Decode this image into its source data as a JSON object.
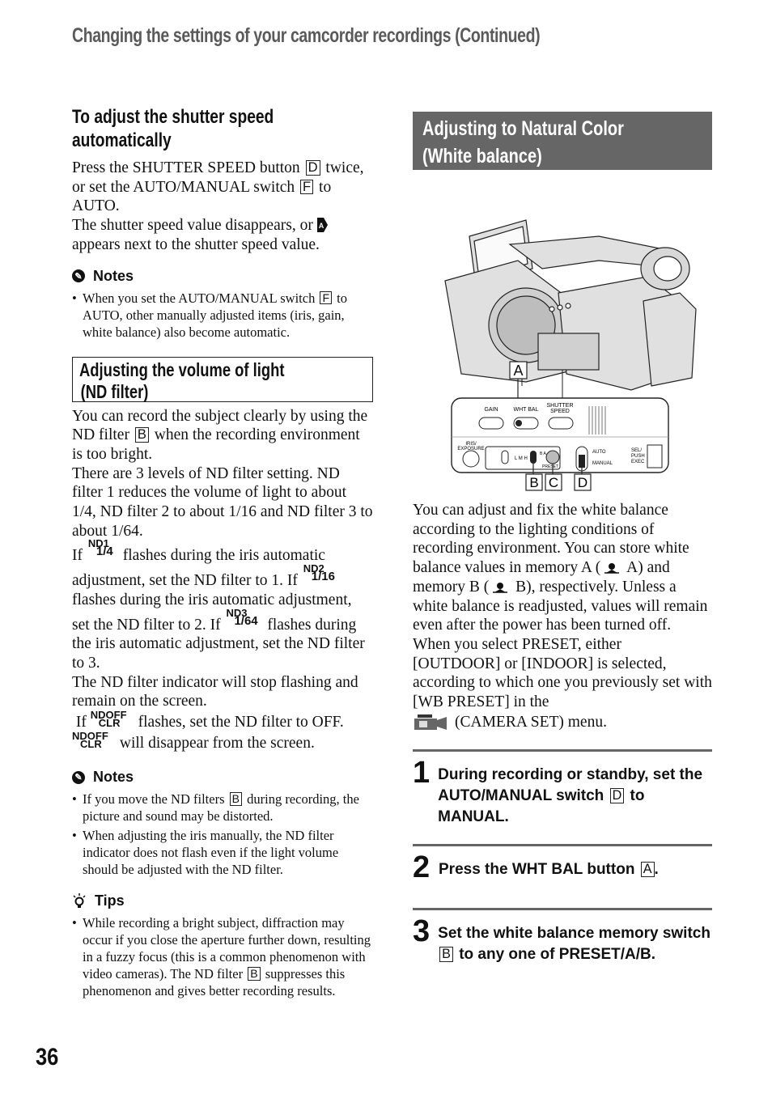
{
  "header": {
    "title": "Changing the settings of your camcorder recordings (Continued)"
  },
  "left": {
    "shutter": {
      "heading_line1": "To adjust the shutter speed",
      "heading_line2": "automatically",
      "p1_a": "Press the SHUTTER SPEED button",
      "p1_box1": "D",
      "p1_b": "twice, or set the AUTO/MANUAL switch",
      "p1_box2": "F",
      "p1_c": "to AUTO.",
      "p2_a": "The shutter speed value disappears, or",
      "p2_b": "appears next to the shutter speed value.",
      "auto_icon_label": "A"
    },
    "notes1": {
      "title": "Notes",
      "items": [
        {
          "a": "When you set the AUTO/MANUAL switch",
          "box": "F",
          "b": "to AUTO, other manually adjusted items (iris, gain, white balance) also become automatic."
        }
      ]
    },
    "nd": {
      "heading_line1": "Adjusting the volume of light",
      "heading_line2": "(ND filter)",
      "p1_a": "You can record the subject clearly by using the ND filter",
      "p1_box": "B",
      "p1_b": "when the recording environment is too bright.",
      "p2": "There are 3 levels of ND filter setting. ND filter 1 reduces the volume of light to about 1/4, ND filter 2 to about 1/16 and ND filter 3 to about 1/64.",
      "p3_if": "If",
      "p3_a": "flashes during the iris automatic adjustment, set the ND filter to 1. If",
      "p3_b": "flashes during the iris automatic adjustment, set the ND filter to 2. If",
      "p3_c": "flashes during the iris automatic adjustment, set the ND filter to 3.",
      "p4": "The ND filter indicator will stop flashing and remain on the screen.",
      "p5_if": "If",
      "p5_a": "flashes, set the ND filter to OFF.",
      "p5_b": "will disappear from the screen.",
      "icons": {
        "nd1_top": "ND1",
        "nd1_bot": "1/4",
        "nd2_top": "ND2",
        "nd2_bot": "1/16",
        "nd3_top": "ND3",
        "nd3_bot": "1/64",
        "ndoff_top": "NDOFF",
        "ndoff_bot": "CLR"
      }
    },
    "notes2": {
      "title": "Notes",
      "items": [
        {
          "a": "If you move the ND filters",
          "box": "B",
          "b": "during recording, the picture and sound may be distorted."
        },
        {
          "a": "When adjusting the iris manually, the ND filter indicator does not flash even if the light volume should be adjusted with the ND filter."
        }
      ]
    },
    "tips": {
      "title": "Tips",
      "items": [
        {
          "a": "While recording a bright subject, diffraction may occur if you close the aperture further down, resulting in a fuzzy focus (this is a common phenomenon with video cameras). The ND filter",
          "box": "B",
          "b": "suppresses this phenomenon and gives better recording results."
        }
      ]
    }
  },
  "right": {
    "wb": {
      "heading_line1": "Adjusting to Natural Color",
      "heading_line2": "(White balance)"
    },
    "figure": {
      "callouts": [
        "A",
        "B",
        "C",
        "D"
      ],
      "labels": {
        "gain": "GAIN",
        "wht_bal": "WHT BAL",
        "shutter1": "SHUTTER",
        "shutter2": "SPEED",
        "iris1": "IRIS/",
        "iris2": "EXPOSURE",
        "lmh": "L M H",
        "preset": "PRESET",
        "ba": "B A",
        "auto": "AUTO",
        "manual": "MANUAL",
        "sel1": "SEL/",
        "sel2": "PUSH",
        "sel3": "EXEC"
      }
    },
    "body": {
      "p1_a": "You can adjust and fix the white balance according to the lighting conditions of recording environment. You can store white balance values in memory A (",
      "p1_b": "A) and memory B (",
      "p1_c": "B), respectively. Unless a white balance is readjusted, values will remain even after the power has been turned off.",
      "p2_a": "When you select PRESET, either [OUTDOOR] or [INDOOR] is selected, according to which one you previously set with [WB PRESET] in the",
      "p2_b": "(CAMERA SET) menu."
    },
    "steps": [
      {
        "num": "1",
        "a": "During recording or standby, set the AUTO/MANUAL switch",
        "box": "D",
        "b": "to MANUAL."
      },
      {
        "num": "2",
        "a": "Press the WHT BAL button",
        "box": "A",
        "b": "."
      },
      {
        "num": "3",
        "a": "Set the white balance memory switch",
        "box": "B",
        "b": "to any one of PRESET/A/B."
      }
    ]
  },
  "footer": {
    "page_number": "36"
  },
  "colors": {
    "title_gray": "#5a5a5a",
    "header_bg": "#666666",
    "step_rule": "#666666"
  }
}
